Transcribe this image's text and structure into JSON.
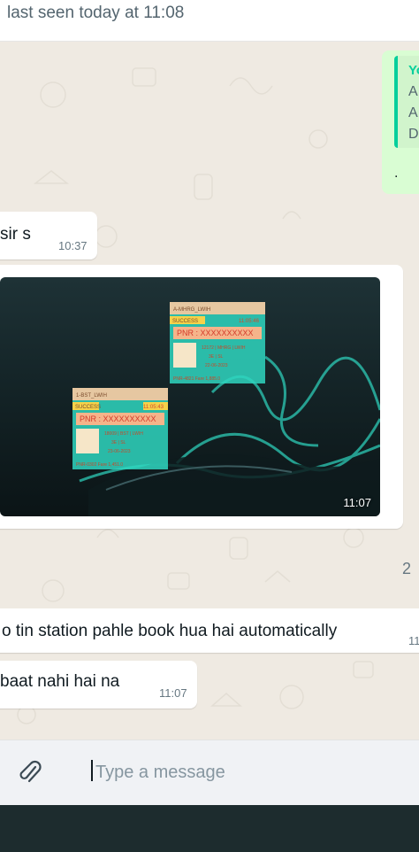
{
  "header": {
    "last_seen": "last seen today at 11:08"
  },
  "messages": {
    "quoted_reply": {
      "author": "Yo",
      "lines": [
        "A",
        "A",
        "D"
      ],
      "trailing": "."
    },
    "msg1": {
      "text": "sir s",
      "time": "10:37"
    },
    "image_msg": {
      "time": "11:07",
      "windows": [
        {
          "title": "A-MHRG_LWIH",
          "status": "SUCCESS",
          "time": "11:05:46",
          "pnr": "PNR : XXXXXXXXXX",
          "rows": [
            "12172 | MHRG | LWIH",
            "3E | SL",
            "22-06-2023"
          ],
          "footer": "PNR-4821 Fare 1,885.0"
        },
        {
          "title": "1-BST_LWIH",
          "status": "SUCCESS",
          "time": "11:05:43",
          "pnr": "PNR : XXXXXXXXXX",
          "rows": [
            "18009 | BST | LWIH",
            "3E | SL",
            "23-06-2023"
          ],
          "footer": "PNR-0302 Fare 1,451.0"
        }
      ]
    },
    "edge_number": "2",
    "msg2": {
      "text": "o tin station pahle book hua hai automatically",
      "time": "11"
    },
    "msg3": {
      "text": "baat nahi hai na",
      "time": "11:07"
    }
  },
  "composer": {
    "placeholder": "Type a message"
  },
  "colors": {
    "chat_bg": "#efeae2",
    "outgoing": "#d9fdd3",
    "accent": "#06cf9c",
    "teal_window": "#2fd6c0"
  },
  "icons": {
    "attach": "paperclip-icon"
  }
}
